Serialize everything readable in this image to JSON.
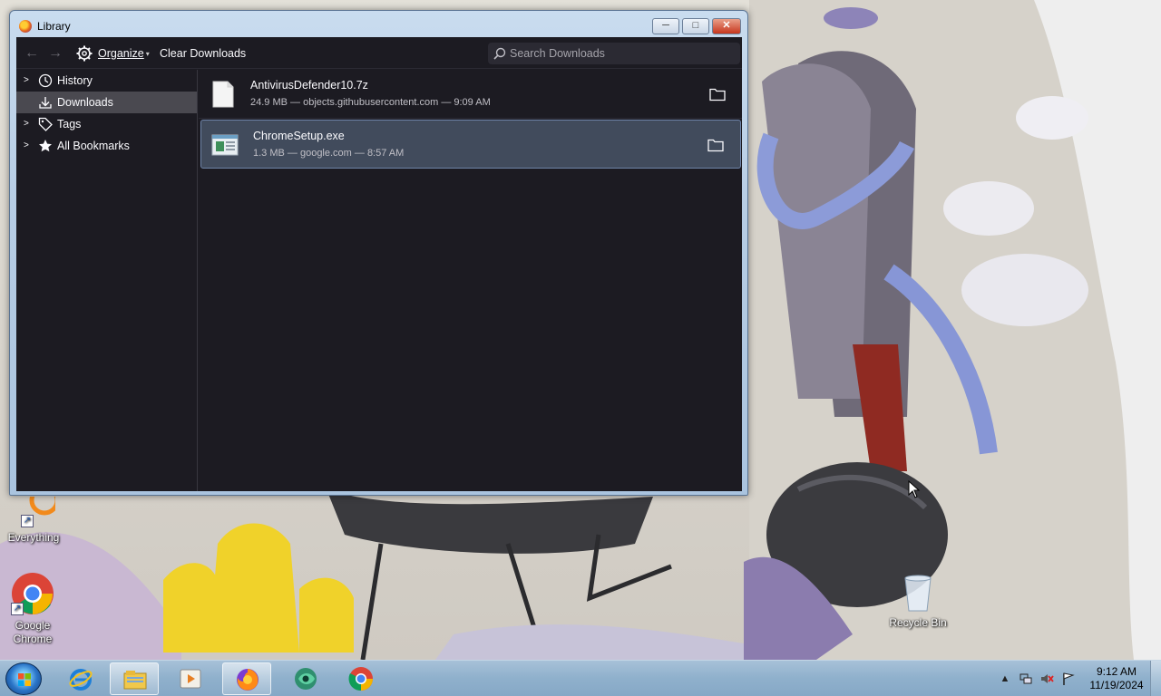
{
  "window": {
    "title": "Library",
    "controls": {
      "minimize": "─",
      "maximize": "□",
      "close": "✕"
    }
  },
  "toolbar": {
    "back_icon": "arrow-left-icon",
    "forward_icon": "arrow-right-icon",
    "organize_label": "Organize",
    "clear_downloads_label": "Clear Downloads",
    "search_placeholder": "Search Downloads"
  },
  "sidebar": {
    "items": [
      {
        "label": "History",
        "icon": "clock-icon",
        "expandable": true,
        "selected": false
      },
      {
        "label": "Downloads",
        "icon": "download-icon",
        "expandable": false,
        "selected": true
      },
      {
        "label": "Tags",
        "icon": "tag-icon",
        "expandable": true,
        "selected": false
      },
      {
        "label": "All Bookmarks",
        "icon": "star-icon",
        "expandable": true,
        "selected": false
      }
    ]
  },
  "downloads": [
    {
      "name": "AntivirusDefender10.7z",
      "meta": "24.9 MB — objects.githubusercontent.com — 9:09 AM",
      "selected": false
    },
    {
      "name": "ChromeSetup.exe",
      "meta": "1.3 MB — google.com — 8:57 AM",
      "selected": true
    }
  ],
  "desktop_icons": [
    {
      "label": "Everything"
    },
    {
      "label": "Google Chrome"
    },
    {
      "label": "Recycle Bin"
    }
  ],
  "taskbar": {
    "apps": [
      "internet-explorer-icon",
      "file-explorer-icon",
      "media-player-icon",
      "firefox-icon",
      "app-icon",
      "chrome-icon"
    ],
    "clock_time": "9:12 AM",
    "clock_date": "11/19/2024"
  },
  "colors": {
    "window_bg": "#1c1b22",
    "selected_row": "#414b5c",
    "sidebar_selected": "#4a4950",
    "taskbar": "#8fb0cc"
  }
}
